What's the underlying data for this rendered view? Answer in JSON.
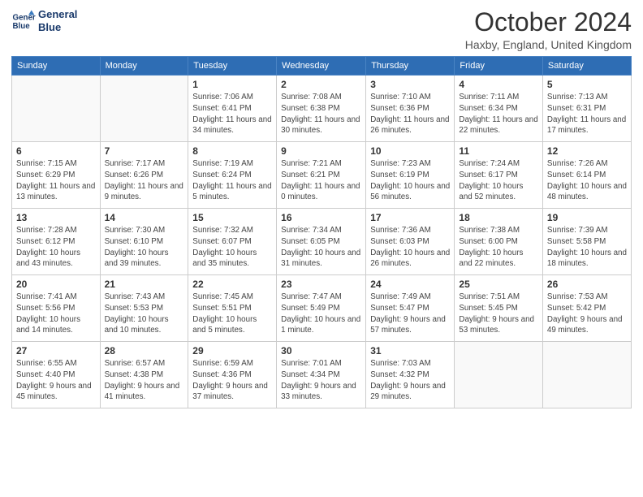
{
  "logo": {
    "line1": "General",
    "line2": "Blue"
  },
  "title": "October 2024",
  "location": "Haxby, England, United Kingdom",
  "days_header": [
    "Sunday",
    "Monday",
    "Tuesday",
    "Wednesday",
    "Thursday",
    "Friday",
    "Saturday"
  ],
  "weeks": [
    [
      {
        "day": "",
        "info": ""
      },
      {
        "day": "",
        "info": ""
      },
      {
        "day": "1",
        "info": "Sunrise: 7:06 AM\nSunset: 6:41 PM\nDaylight: 11 hours and 34 minutes."
      },
      {
        "day": "2",
        "info": "Sunrise: 7:08 AM\nSunset: 6:38 PM\nDaylight: 11 hours and 30 minutes."
      },
      {
        "day": "3",
        "info": "Sunrise: 7:10 AM\nSunset: 6:36 PM\nDaylight: 11 hours and 26 minutes."
      },
      {
        "day": "4",
        "info": "Sunrise: 7:11 AM\nSunset: 6:34 PM\nDaylight: 11 hours and 22 minutes."
      },
      {
        "day": "5",
        "info": "Sunrise: 7:13 AM\nSunset: 6:31 PM\nDaylight: 11 hours and 17 minutes."
      }
    ],
    [
      {
        "day": "6",
        "info": "Sunrise: 7:15 AM\nSunset: 6:29 PM\nDaylight: 11 hours and 13 minutes."
      },
      {
        "day": "7",
        "info": "Sunrise: 7:17 AM\nSunset: 6:26 PM\nDaylight: 11 hours and 9 minutes."
      },
      {
        "day": "8",
        "info": "Sunrise: 7:19 AM\nSunset: 6:24 PM\nDaylight: 11 hours and 5 minutes."
      },
      {
        "day": "9",
        "info": "Sunrise: 7:21 AM\nSunset: 6:21 PM\nDaylight: 11 hours and 0 minutes."
      },
      {
        "day": "10",
        "info": "Sunrise: 7:23 AM\nSunset: 6:19 PM\nDaylight: 10 hours and 56 minutes."
      },
      {
        "day": "11",
        "info": "Sunrise: 7:24 AM\nSunset: 6:17 PM\nDaylight: 10 hours and 52 minutes."
      },
      {
        "day": "12",
        "info": "Sunrise: 7:26 AM\nSunset: 6:14 PM\nDaylight: 10 hours and 48 minutes."
      }
    ],
    [
      {
        "day": "13",
        "info": "Sunrise: 7:28 AM\nSunset: 6:12 PM\nDaylight: 10 hours and 43 minutes."
      },
      {
        "day": "14",
        "info": "Sunrise: 7:30 AM\nSunset: 6:10 PM\nDaylight: 10 hours and 39 minutes."
      },
      {
        "day": "15",
        "info": "Sunrise: 7:32 AM\nSunset: 6:07 PM\nDaylight: 10 hours and 35 minutes."
      },
      {
        "day": "16",
        "info": "Sunrise: 7:34 AM\nSunset: 6:05 PM\nDaylight: 10 hours and 31 minutes."
      },
      {
        "day": "17",
        "info": "Sunrise: 7:36 AM\nSunset: 6:03 PM\nDaylight: 10 hours and 26 minutes."
      },
      {
        "day": "18",
        "info": "Sunrise: 7:38 AM\nSunset: 6:00 PM\nDaylight: 10 hours and 22 minutes."
      },
      {
        "day": "19",
        "info": "Sunrise: 7:39 AM\nSunset: 5:58 PM\nDaylight: 10 hours and 18 minutes."
      }
    ],
    [
      {
        "day": "20",
        "info": "Sunrise: 7:41 AM\nSunset: 5:56 PM\nDaylight: 10 hours and 14 minutes."
      },
      {
        "day": "21",
        "info": "Sunrise: 7:43 AM\nSunset: 5:53 PM\nDaylight: 10 hours and 10 minutes."
      },
      {
        "day": "22",
        "info": "Sunrise: 7:45 AM\nSunset: 5:51 PM\nDaylight: 10 hours and 5 minutes."
      },
      {
        "day": "23",
        "info": "Sunrise: 7:47 AM\nSunset: 5:49 PM\nDaylight: 10 hours and 1 minute."
      },
      {
        "day": "24",
        "info": "Sunrise: 7:49 AM\nSunset: 5:47 PM\nDaylight: 9 hours and 57 minutes."
      },
      {
        "day": "25",
        "info": "Sunrise: 7:51 AM\nSunset: 5:45 PM\nDaylight: 9 hours and 53 minutes."
      },
      {
        "day": "26",
        "info": "Sunrise: 7:53 AM\nSunset: 5:42 PM\nDaylight: 9 hours and 49 minutes."
      }
    ],
    [
      {
        "day": "27",
        "info": "Sunrise: 6:55 AM\nSunset: 4:40 PM\nDaylight: 9 hours and 45 minutes."
      },
      {
        "day": "28",
        "info": "Sunrise: 6:57 AM\nSunset: 4:38 PM\nDaylight: 9 hours and 41 minutes."
      },
      {
        "day": "29",
        "info": "Sunrise: 6:59 AM\nSunset: 4:36 PM\nDaylight: 9 hours and 37 minutes."
      },
      {
        "day": "30",
        "info": "Sunrise: 7:01 AM\nSunset: 4:34 PM\nDaylight: 9 hours and 33 minutes."
      },
      {
        "day": "31",
        "info": "Sunrise: 7:03 AM\nSunset: 4:32 PM\nDaylight: 9 hours and 29 minutes."
      },
      {
        "day": "",
        "info": ""
      },
      {
        "day": "",
        "info": ""
      }
    ]
  ]
}
